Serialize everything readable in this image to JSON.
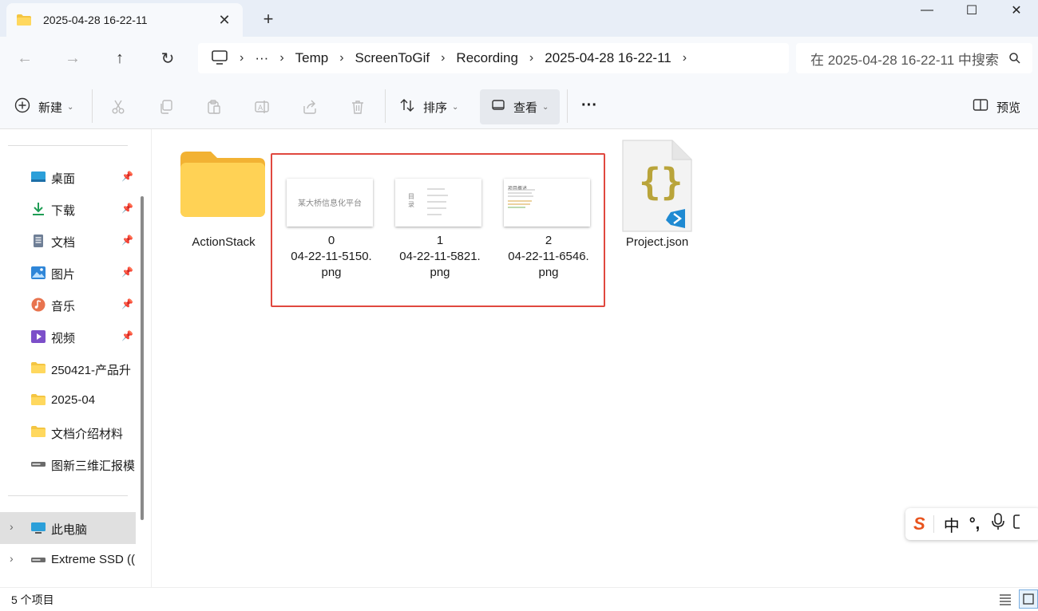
{
  "tab": {
    "title": "2025-04-28 16-22-11",
    "close": "✕",
    "new": "+"
  },
  "window": {
    "minimize": "—",
    "maximize": "☐",
    "close": "✕"
  },
  "nav": {
    "back": "←",
    "forward": "→",
    "up": "↑",
    "refresh": "↻"
  },
  "breadcrumb": {
    "more": "···",
    "items": [
      "Temp",
      "ScreenToGif",
      "Recording",
      "2025-04-28 16-22-11"
    ]
  },
  "search": {
    "placeholder": "在 2025-04-28 16-22-11 中搜索"
  },
  "toolbar": {
    "new_label": "新建",
    "sort_label": "排序",
    "view_label": "查看",
    "more_label": "···",
    "preview_label": "预览"
  },
  "sidebar": {
    "quick": [
      {
        "label": "桌面",
        "icon": "desktop-icon",
        "pinned": true
      },
      {
        "label": "下载",
        "icon": "download-icon",
        "pinned": true
      },
      {
        "label": "文档",
        "icon": "document-icon",
        "pinned": true
      },
      {
        "label": "图片",
        "icon": "pictures-icon",
        "pinned": true
      },
      {
        "label": "音乐",
        "icon": "music-icon",
        "pinned": true
      },
      {
        "label": "视频",
        "icon": "video-icon",
        "pinned": true
      },
      {
        "label": "250421-产品升",
        "icon": "folder-icon",
        "pinned": false
      },
      {
        "label": "2025-04",
        "icon": "folder-icon",
        "pinned": false
      },
      {
        "label": "文档介绍材料",
        "icon": "folder-icon",
        "pinned": false
      },
      {
        "label": "图新三维汇报模",
        "icon": "drive-icon",
        "pinned": false
      }
    ],
    "this_pc": "此电脑",
    "drive": "Extreme SSD (("
  },
  "files": [
    {
      "name": "ActionStack",
      "type": "folder"
    },
    {
      "name_line1": "0",
      "name_line2": "04-22-11-5150.",
      "name_line3": "png",
      "type": "image",
      "thumb_text": "某大桥信息化平台"
    },
    {
      "name_line1": "1",
      "name_line2": "04-22-11-5821.",
      "name_line3": "png",
      "type": "image",
      "thumb_text": "目录"
    },
    {
      "name_line1": "2",
      "name_line2": "04-22-11-6546.",
      "name_line3": "png",
      "type": "image",
      "thumb_text": "项目概述"
    },
    {
      "name": "Project.json",
      "type": "json"
    }
  ],
  "status": {
    "count": "5 个项目"
  },
  "ime": {
    "logo": "S",
    "mode": "中",
    "punct": "°,",
    "mic": "mic-icon"
  },
  "colors": {
    "accent": "#0067c0",
    "highlight": "#e0483f",
    "folder": "#f4c542"
  }
}
